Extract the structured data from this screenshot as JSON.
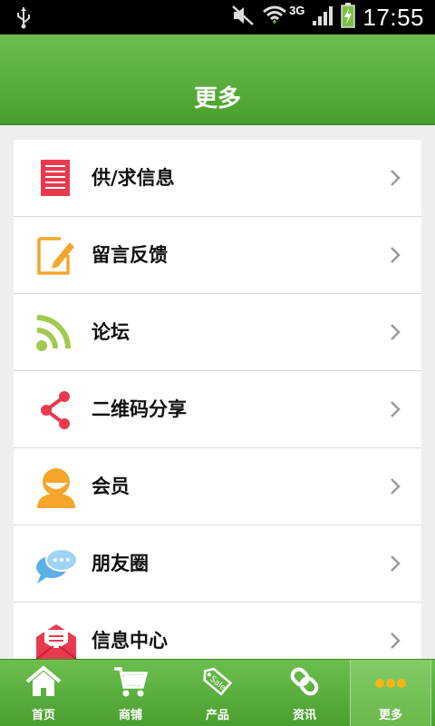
{
  "status_bar": {
    "time": "17:55",
    "network": "3G"
  },
  "header": {
    "title": "更多"
  },
  "menu": {
    "items": [
      {
        "label": "供/求信息",
        "icon": "document-list-icon"
      },
      {
        "label": "留言反馈",
        "icon": "edit-note-icon"
      },
      {
        "label": "论坛",
        "icon": "rss-icon"
      },
      {
        "label": "二维码分享",
        "icon": "share-icon"
      },
      {
        "label": "会员",
        "icon": "user-icon"
      },
      {
        "label": "朋友圈",
        "icon": "chat-bubbles-icon"
      },
      {
        "label": "信息中心",
        "icon": "mail-icon"
      }
    ]
  },
  "bottom_nav": {
    "tabs": [
      {
        "label": "首页",
        "icon": "home-icon"
      },
      {
        "label": "商铺",
        "icon": "cart-icon"
      },
      {
        "label": "产品",
        "icon": "sale-tag-icon"
      },
      {
        "label": "资讯",
        "icon": "link-icon"
      },
      {
        "label": "更多",
        "icon": "more-dots-icon",
        "active": true
      }
    ]
  },
  "colors": {
    "brand_green": "#5cb33e",
    "background": "#eeeeee"
  }
}
